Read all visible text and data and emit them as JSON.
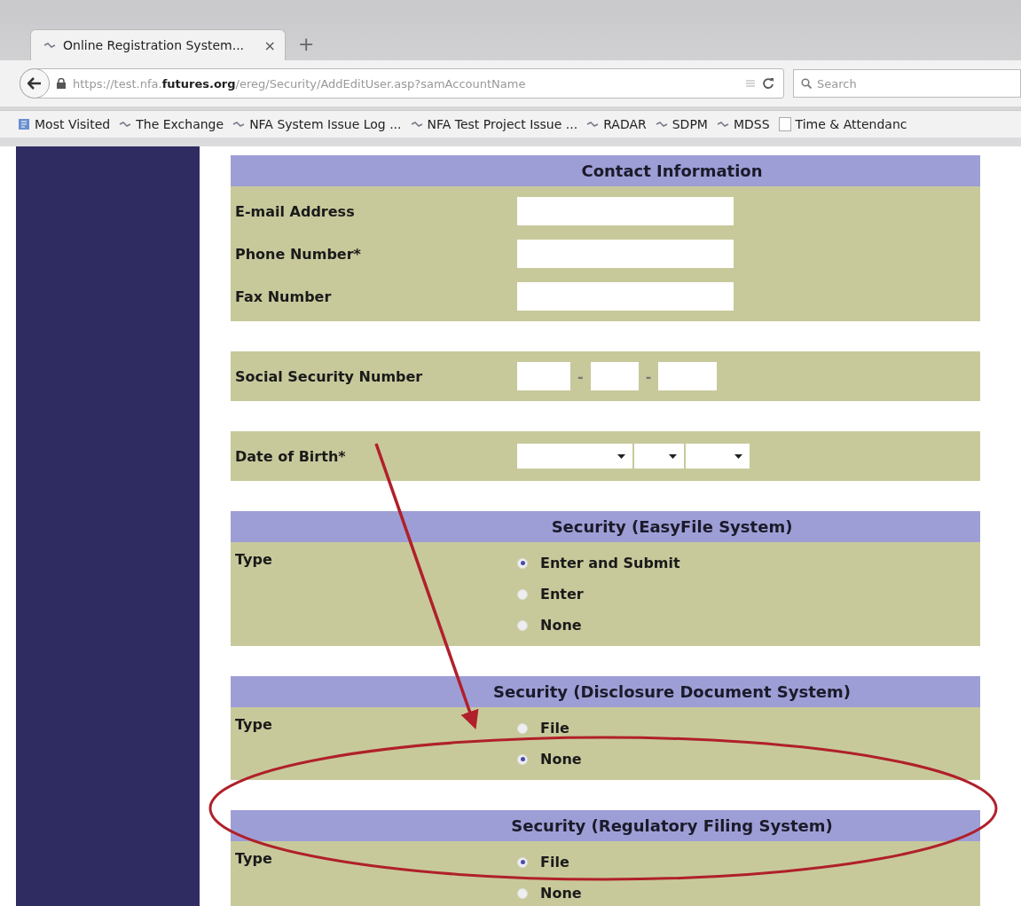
{
  "browser": {
    "tab": {
      "title": "Online Registration System...",
      "close": "×"
    },
    "new_tab": "+",
    "url": {
      "scheme_host": "https://test.nfa.",
      "domain": "futures.org",
      "path": "/ereg/Security/AddEditUser.asp?samAccountName"
    },
    "search": {
      "placeholder": "Search"
    },
    "bookmarks": [
      {
        "label": "Most Visited",
        "kind": "menu"
      },
      {
        "label": "The Exchange",
        "kind": "site"
      },
      {
        "label": "NFA System Issue Log ...",
        "kind": "site"
      },
      {
        "label": "NFA Test Project Issue ...",
        "kind": "site"
      },
      {
        "label": "RADAR",
        "kind": "site"
      },
      {
        "label": "SDPM",
        "kind": "site"
      },
      {
        "label": "MDSS",
        "kind": "site"
      },
      {
        "label": "Time & Attendanc",
        "kind": "page"
      }
    ]
  },
  "sections": [
    {
      "kind": "fields",
      "title": "Contact Information",
      "rows": [
        {
          "label": "E-mail Address",
          "kind": "text"
        },
        {
          "label": "Phone Number*",
          "kind": "text"
        },
        {
          "label": "Fax Number",
          "kind": "text"
        }
      ]
    },
    {
      "kind": "fields",
      "rows": [
        {
          "label": "Social Security Number",
          "kind": "ssn",
          "separator": "-"
        }
      ]
    },
    {
      "kind": "fields",
      "rows": [
        {
          "label": "Date of Birth*",
          "kind": "date"
        }
      ]
    },
    {
      "kind": "radio",
      "title": "Security (EasyFile System)",
      "label": "Type",
      "options": [
        {
          "label": "Enter and Submit",
          "selected": true
        },
        {
          "label": "Enter",
          "selected": false
        },
        {
          "label": "None",
          "selected": false
        }
      ]
    },
    {
      "kind": "radio",
      "title": "Security (Disclosure Document System)",
      "label": "Type",
      "options": [
        {
          "label": "File",
          "selected": false
        },
        {
          "label": "None",
          "selected": true
        }
      ]
    },
    {
      "kind": "radio",
      "title": "Security  (Regulatory Filing System)",
      "label": "Type",
      "options": [
        {
          "label": "File",
          "selected": true
        },
        {
          "label": "None",
          "selected": false
        }
      ]
    }
  ]
}
